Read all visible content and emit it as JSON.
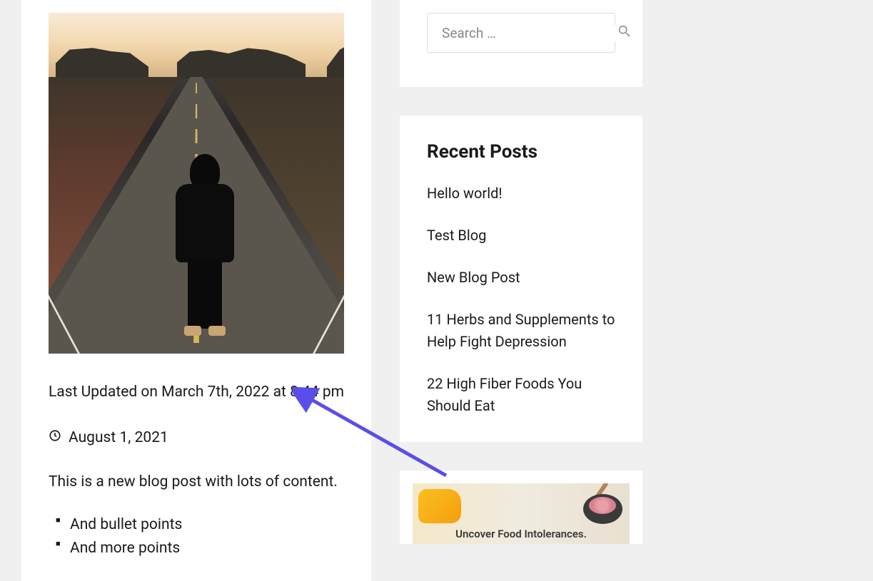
{
  "post": {
    "last_updated": "Last Updated on March 7th, 2022 at 8:44 pm",
    "published_date": "August 1, 2021",
    "body_text": "This is a new blog post with lots of content.",
    "bullets": [
      "And bullet points",
      "And more points"
    ]
  },
  "search": {
    "placeholder": "Search …"
  },
  "sidebar": {
    "recent_posts_title": "Recent Posts",
    "recent_posts": [
      "Hello world!",
      "Test Blog",
      "New Blog Post",
      "11 Herbs and Supplements to Help Fight Depression",
      "22 High Fiber Foods You Should Eat"
    ],
    "ad_text": "Uncover Food Intolerances."
  }
}
